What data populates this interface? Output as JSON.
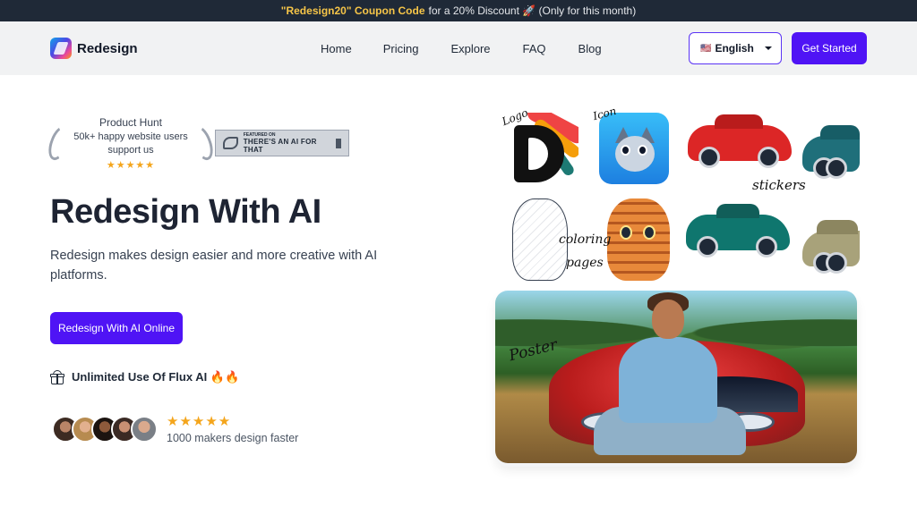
{
  "promo": {
    "code": "\"Redesign20\" Coupon Code",
    "text": "for a 20% Discount 🚀 (Only for this month)"
  },
  "nav": {
    "brand": "Redesign",
    "links": [
      "Home",
      "Pricing",
      "Explore",
      "FAQ",
      "Blog"
    ],
    "language": {
      "flag": "🇺🇸",
      "label": "English"
    },
    "cta": "Get Started"
  },
  "badges": {
    "product_hunt": {
      "title": "Product Hunt",
      "users": "50k+ happy website users support us",
      "stars": "★★★★★",
      "rating": 5
    },
    "aift": {
      "small": "FEATURED ON",
      "main": "THERE'S AN AI FOR THAT"
    }
  },
  "hero": {
    "title": "Redesign With AI",
    "description": "Redesign makes design easier and more creative with AI platforms.",
    "cta": "Redesign With AI Online",
    "feature": "Unlimited Use Of Flux AI 🔥🔥"
  },
  "social_proof": {
    "stars": "★★★★★",
    "rating": 5,
    "text": "1000 makers design faster"
  },
  "gallery": {
    "labels": {
      "logo": "Logo",
      "icon": "Icon",
      "stickers": "stickers",
      "coloring": "coloring",
      "pages": "pages",
      "poster": "Poster"
    }
  },
  "colors": {
    "accent": "#4f14f5",
    "promo_bg": "#1f2937",
    "promo_code": "#f6c548",
    "star": "#f4a51c"
  }
}
